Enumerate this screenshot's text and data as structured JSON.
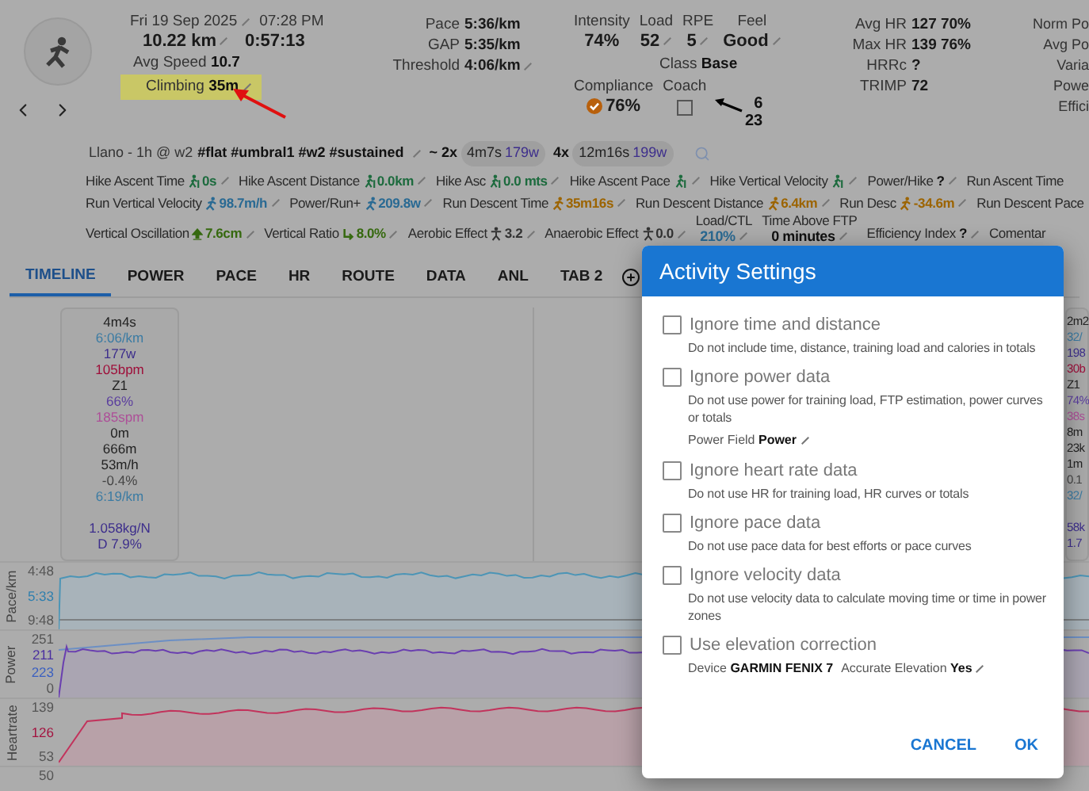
{
  "header": {
    "date": "Fri 19 Sep 2025",
    "time": "07:28 PM",
    "distance": "10.22 km",
    "duration": "0:57:13",
    "avg_speed": {
      "label": "Avg Speed",
      "value": "10.7"
    },
    "climbing": {
      "label": "Climbing",
      "value": "35m",
      "highlighted": true
    }
  },
  "pace_stats": [
    {
      "label": "Pace",
      "value": "5:36/km",
      "editable": false
    },
    {
      "label": "GAP",
      "value": "5:35/km",
      "editable": false
    },
    {
      "label": "Threshold",
      "value": "4:06/km",
      "editable": true
    }
  ],
  "effort_stats": [
    {
      "label": "Intensity",
      "value": "74%",
      "editable": false
    },
    {
      "label": "Load",
      "value": "52",
      "editable": true
    },
    {
      "label": "RPE",
      "value": "5",
      "editable": true
    },
    {
      "label": "Feel",
      "value": "Good",
      "editable": true
    }
  ],
  "class": {
    "label": "Class",
    "value": "Base"
  },
  "compliance": {
    "label": "Compliance",
    "value": "76%"
  },
  "coach": {
    "label": "Coach",
    "checked": false
  },
  "annotation_numbers": [
    "6",
    "23"
  ],
  "hr_stats": [
    {
      "label": "Avg HR",
      "value": "127 70%"
    },
    {
      "label": "Max HR",
      "value": "139 76%"
    },
    {
      "label": "HRRc",
      "value": "?"
    },
    {
      "label": "TRIMP",
      "value": "72"
    }
  ],
  "power_labels": [
    "Norm Po",
    "Avg Po",
    "Varia",
    "Powe",
    "Effici"
  ],
  "description": {
    "title": "Llano - 1h @ w2",
    "tags": "#flat #umbral1 #w2 #sustained",
    "intervals": [
      {
        "count": "~ 2x",
        "time": "4m7s",
        "power": "179w"
      },
      {
        "count": "4x",
        "time": "12m16s",
        "power": "199w"
      }
    ]
  },
  "field_rows": [
    [
      {
        "kind": "hike",
        "label": "Hike Ascent Time",
        "value": "0s",
        "color": "#1d6b3e",
        "editable": true
      },
      {
        "kind": "hike",
        "label": "Hike Ascent Distance",
        "value": "0.0km",
        "color": "#1d6b3e",
        "editable": true
      },
      {
        "kind": "hike",
        "label": "Hike Asc",
        "value": "0.0 mts",
        "color": "#1d6b3e",
        "editable": true
      },
      {
        "kind": "hike",
        "label": "Hike Ascent Pace",
        "color": "#1d6b3e",
        "editable": true
      },
      {
        "kind": "hike",
        "label": "Hike Vertical Velocity",
        "color": "#1d6b3e",
        "editable": true
      },
      {
        "kind": "plain",
        "label": "Power/Hike",
        "value": "?",
        "color": "#111111",
        "editable": true
      },
      {
        "kind": "plain",
        "label": "Run Ascent Time",
        "editable": false
      }
    ],
    [
      {
        "kind": "run",
        "label": "Run Vertical Velocity",
        "value": "98.7m/h",
        "color": "#2a6a93",
        "editable": true
      },
      {
        "kind": "run",
        "label": "Power/Run+",
        "value": "209.8w",
        "color": "#2a6a93",
        "editable": true
      },
      {
        "kind": "run",
        "label": "Run Descent Time",
        "value": "35m16s",
        "color": "#9c6400",
        "editable": true
      },
      {
        "kind": "run",
        "label": "Run Descent Distance",
        "value": "6.4km",
        "color": "#9c6400",
        "editable": true
      },
      {
        "kind": "run",
        "label": "Run Desc",
        "value": "-34.6m",
        "color": "#9c6400",
        "editable": true
      },
      {
        "kind": "plain",
        "label": "Run Descent Pace",
        "editable": false
      }
    ],
    [
      {
        "kind": "rise",
        "label": "Vertical Oscillation",
        "value": "7.6cm",
        "color": "#36690f",
        "editable": true
      },
      {
        "kind": "ratio",
        "label": "Vertical Ratio",
        "value": "8.0%",
        "color": "#36690f",
        "editable": true
      },
      {
        "kind": "effect",
        "label": "Aerobic Effect",
        "value": "3.2",
        "color": "#333333",
        "editable": true
      },
      {
        "kind": "effect",
        "label": "Anaerobic Effect",
        "value": "0.0",
        "color": "#333333",
        "editable": true
      },
      {
        "kind": "stacked",
        "label": "Load/CTL",
        "value": "210%",
        "color": "#2a6a93",
        "editable": true
      },
      {
        "kind": "stacked",
        "label": "Time Above FTP",
        "value": "0 minutes",
        "color": "#111111",
        "editable": true
      },
      {
        "kind": "plain",
        "label": "Efficiency Index",
        "value": "?",
        "color": "#111111",
        "editable": true
      },
      {
        "kind": "plain",
        "label": "Comentar",
        "editable": false
      }
    ]
  ],
  "tabs": [
    {
      "label": "TIMELINE",
      "selected": true
    },
    {
      "label": "POWER",
      "selected": false
    },
    {
      "label": "PACE",
      "selected": false
    },
    {
      "label": "HR",
      "selected": false
    },
    {
      "label": "ROUTE",
      "selected": false
    },
    {
      "label": "DATA",
      "selected": false
    },
    {
      "label": "ANL",
      "selected": false
    },
    {
      "label": "TAB 2",
      "selected": false
    }
  ],
  "interval_card": {
    "values": [
      {
        "text": "4m4s",
        "color": "#222222"
      },
      {
        "text": "6:06/km",
        "color": "#3b7ba3"
      },
      {
        "text": "177w",
        "color": "#3d2e8c"
      },
      {
        "text": "105bpm",
        "color": "#9e0f3a"
      },
      {
        "text": "Z1",
        "color": "#222222"
      },
      {
        "text": "66%",
        "color": "#5a3d9e"
      },
      {
        "text": "185spm",
        "color": "#ad4f98"
      },
      {
        "text": "0m",
        "color": "#222222"
      },
      {
        "text": "666m",
        "color": "#222222"
      },
      {
        "text": "53m/h",
        "color": "#222222"
      },
      {
        "text": "-0.4%",
        "color": "#444444"
      },
      {
        "text": "6:19/km",
        "color": "#3b7ba3"
      }
    ],
    "extra_values": [
      {
        "text": "1.058kg/N",
        "color": "#3d2e8c"
      },
      {
        "text": "D 7.9%",
        "color": "#3d2e8c"
      }
    ]
  },
  "second_card": {
    "values": [
      {
        "text": "2m2",
        "color": "#222222"
      },
      {
        "text": "32/",
        "color": "#3b7ba3"
      },
      {
        "text": "198",
        "color": "#3d2e8c"
      },
      {
        "text": "30b",
        "color": "#9e0f3a"
      },
      {
        "text": "Z1",
        "color": "#222222"
      },
      {
        "text": "74%",
        "color": "#5a3d9e"
      },
      {
        "text": "38s",
        "color": "#ad4f98"
      },
      {
        "text": "8m",
        "color": "#222222"
      },
      {
        "text": "23k",
        "color": "#222222"
      },
      {
        "text": "1m",
        "color": "#222222"
      },
      {
        "text": "0.1",
        "color": "#444444"
      },
      {
        "text": "32/",
        "color": "#3b7ba3"
      }
    ],
    "extra_values": [
      {
        "text": "58k",
        "color": "#3d2e8c"
      },
      {
        "text": "1.7",
        "color": "#3d2e8c"
      }
    ]
  },
  "charts": [
    {
      "kind": "pace",
      "label": "Pace/km",
      "ticks": [
        {
          "text": "4:48",
          "color": "#555555"
        },
        {
          "text": "5:33",
          "color": "#2f7fae"
        },
        {
          "text": "9:48",
          "color": "#555555"
        }
      ]
    },
    {
      "kind": "power",
      "label": "Power",
      "ticks": [
        {
          "text": "251",
          "color": "#555555"
        },
        {
          "text": "211",
          "color": "#4a2fa0"
        },
        {
          "text": "223",
          "color": "#3a5fc0"
        },
        {
          "text": "0",
          "color": "#555555"
        }
      ]
    },
    {
      "kind": "heartrate",
      "label": "Heartrate",
      "ticks": [
        {
          "text": "139",
          "color": "#555555"
        },
        {
          "text": "126",
          "color": "#a3123f"
        },
        {
          "text": "53",
          "color": "#555555"
        }
      ]
    }
  ],
  "next_chart_tick": "50",
  "dialog": {
    "title": "Activity Settings",
    "options": [
      {
        "label": "Ignore time and distance",
        "checked": false,
        "description": "Do not include time, distance, training load and calories in totals"
      },
      {
        "label": "Ignore power data",
        "checked": false,
        "description": "Do not use power for training load, FTP estimation, power curves or totals",
        "settings": [
          {
            "label": "Power Field",
            "value": "Power",
            "editable": true
          }
        ]
      },
      {
        "label": "Ignore heart rate data",
        "checked": false,
        "description": "Do not use HR for training load, HR curves or totals"
      },
      {
        "label": "Ignore pace data",
        "checked": false,
        "description": "Do not use pace data for best efforts or pace curves"
      },
      {
        "label": "Ignore velocity data",
        "checked": false,
        "description": "Do not use velocity data to calculate moving time or time in power zones"
      },
      {
        "label": "Use elevation correction",
        "checked": false,
        "settings": [
          {
            "label": "Device",
            "value": "GARMIN FENIX 7",
            "editable": false
          },
          {
            "label": "Accurate Elevation",
            "value": "Yes",
            "editable": true
          }
        ]
      }
    ],
    "buttons": [
      "CANCEL",
      "OK"
    ]
  }
}
